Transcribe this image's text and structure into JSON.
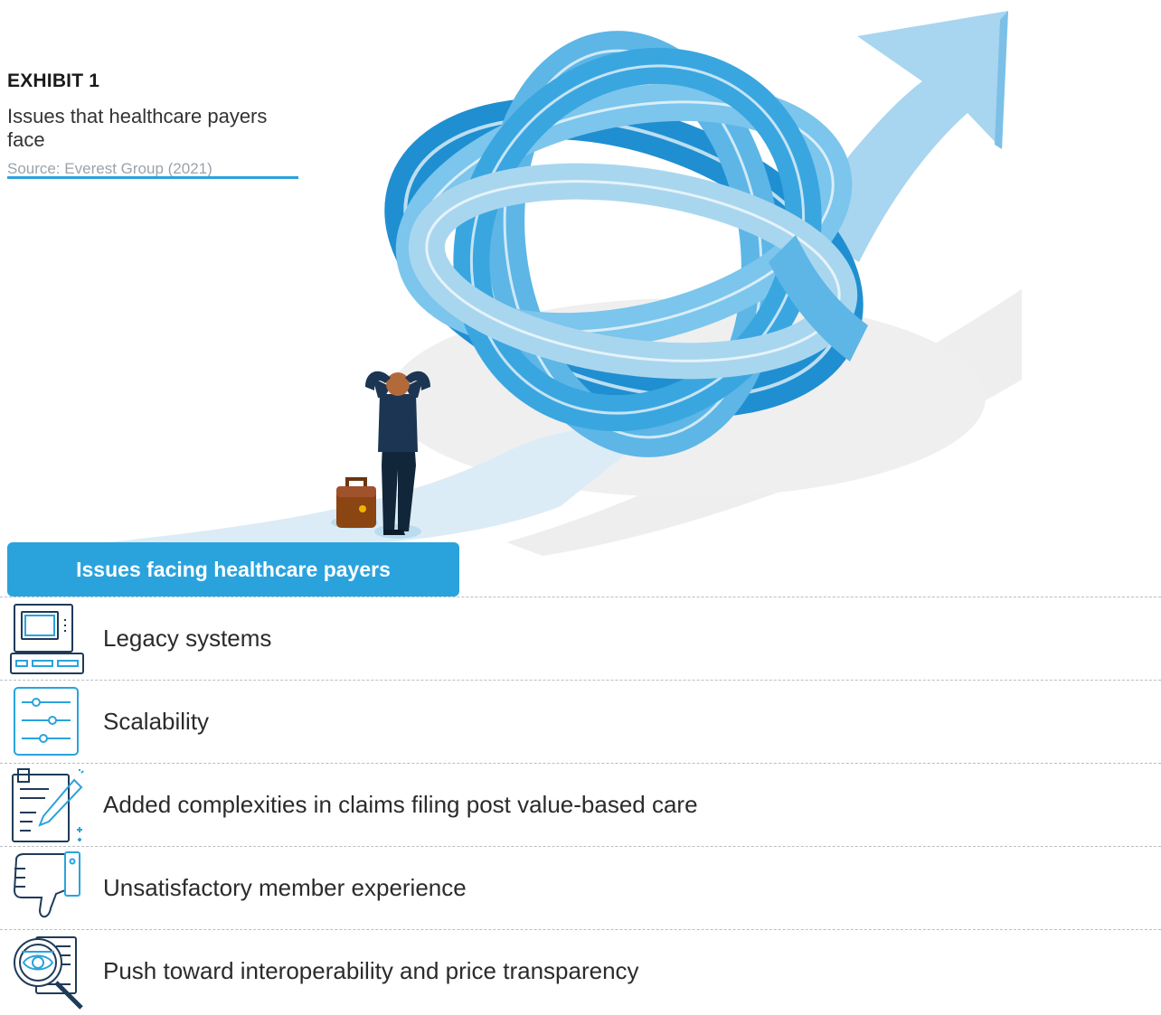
{
  "header": {
    "exhibit": "EXHIBIT 1",
    "subtitle": "Issues that healthcare payers face",
    "source": "Source: Everest Group (2021)"
  },
  "issues_header": "Issues facing healthcare payers",
  "issues": [
    {
      "label": "Legacy systems",
      "icon": "legacy-computer-icon"
    },
    {
      "label": "Scalability",
      "icon": "sliders-icon"
    },
    {
      "label": "Added complexities in claims filing post value-based care",
      "icon": "claims-form-pen-icon"
    },
    {
      "label": "Unsatisfactory member experience",
      "icon": "thumbs-down-icon"
    },
    {
      "label": "Push toward interoperability and price transparency",
      "icon": "document-magnifier-eye-icon"
    }
  ],
  "colors": {
    "accent": "#2aa3dd",
    "ribbon_light": "#a9d6ef",
    "ribbon_mid": "#5db6e6",
    "ribbon_dark": "#1f8fd1",
    "shadow": "#ececec"
  }
}
